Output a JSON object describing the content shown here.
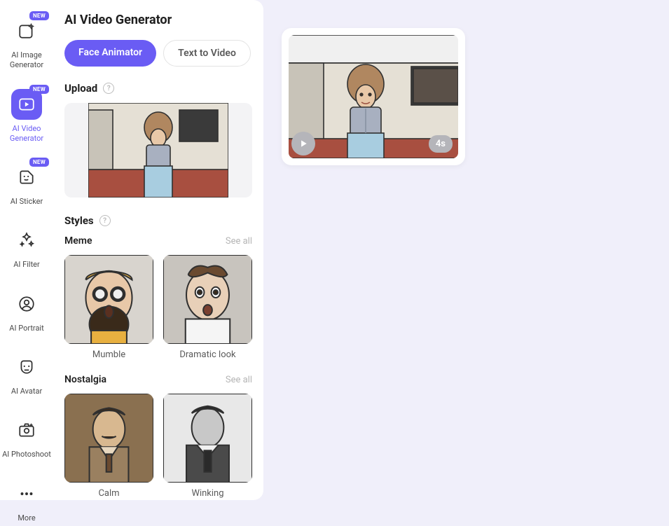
{
  "sidebar": {
    "items": [
      {
        "label": "AI Image Generator",
        "new": true
      },
      {
        "label": "AI Video Generator",
        "new": true,
        "active": true
      },
      {
        "label": "AI Sticker",
        "new": true
      },
      {
        "label": "AI Filter"
      },
      {
        "label": "AI Portrait"
      },
      {
        "label": "AI Avatar"
      },
      {
        "label": "AI Photoshoot"
      },
      {
        "label": "More"
      }
    ],
    "new_badge": "NEW"
  },
  "panel": {
    "title": "AI Video Generator",
    "tabs": [
      {
        "label": "Face Animator",
        "active": true
      },
      {
        "label": "Text to Video",
        "active": false
      }
    ],
    "upload": {
      "title": "Upload"
    },
    "styles": {
      "title": "Styles",
      "groups": [
        {
          "name": "Meme",
          "see_all": "See all",
          "items": [
            {
              "label": "Mumble"
            },
            {
              "label": "Dramatic look"
            }
          ]
        },
        {
          "name": "Nostalgia",
          "see_all": "See all",
          "items": [
            {
              "label": "Calm"
            },
            {
              "label": "Winking"
            }
          ]
        }
      ]
    }
  },
  "canvas": {
    "video": {
      "duration": "4s"
    }
  }
}
